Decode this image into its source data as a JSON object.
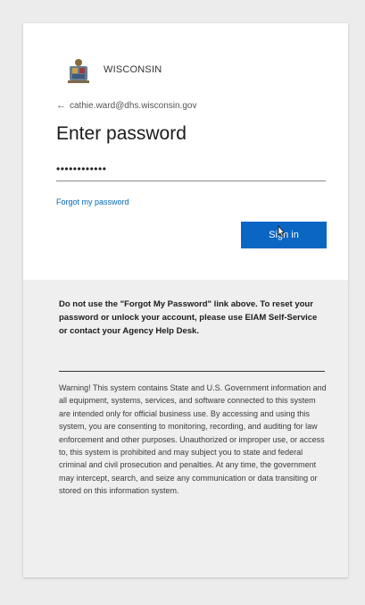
{
  "header": {
    "org_name": "WISCONSIN",
    "seal_icon": "wisconsin-seal-icon"
  },
  "account": {
    "back_icon": "back-arrow-icon",
    "email": "cathie.ward@dhs.wisconsin.gov"
  },
  "form": {
    "title": "Enter password",
    "password_value": "••••••••••••",
    "forgot_label": "Forgot my password",
    "signin_label": "Sign in"
  },
  "notice": {
    "text": "Do not use the \"Forgot My Password\" link above. To reset your password or unlock your account, please use EIAM Self-Service or contact your Agency Help Desk."
  },
  "warning": {
    "text": "Warning! This system contains State and U.S. Government information and all equipment, systems, services, and software connected to this system are intended only for official business use. By accessing and using this system, you are consenting to monitoring, recording, and auditing for law enforcement and other purposes. Unauthorized or improper use, or access to, this system is prohibited and may subject you to state and federal criminal and civil prosecution and penalties. At any time, the government may intercept, search, and seize any communication or data transiting or stored on this information system."
  },
  "colors": {
    "accent": "#0a66c2",
    "link": "#0067b8",
    "bottom_panel": "#efefef"
  }
}
